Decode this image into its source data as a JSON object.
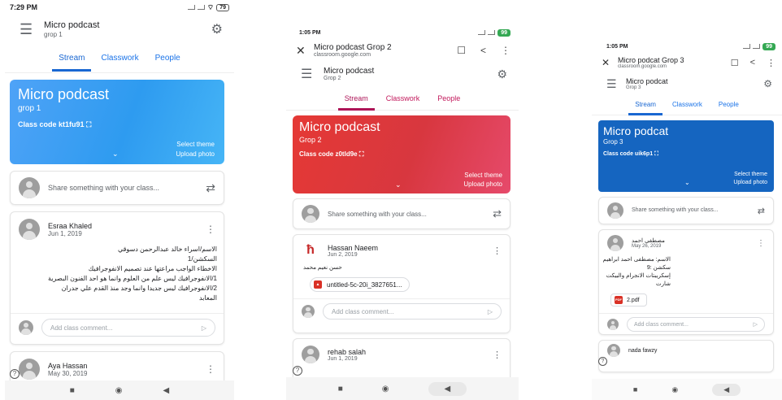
{
  "icons": {
    "menu": "☰",
    "gear": "⚙",
    "swap": "⇄",
    "kebab": "⋮",
    "send": "▷",
    "chevron": "⌄",
    "qr": "⛶",
    "close": "✕",
    "lock": "🔒",
    "bookmark": "☐",
    "share": "<",
    "nav_square": "■",
    "nav_circle": "◉",
    "nav_back": "◀",
    "help": "?"
  },
  "phones": [
    {
      "status_time": "7:29 PM",
      "battery": "79",
      "class_name": "Micro podcast",
      "section": "grop 1",
      "tabs": [
        "Stream",
        "Classwork",
        "People"
      ],
      "banner": {
        "title": "Micro podcast",
        "section": "grop 1",
        "class_code_label": "Class code",
        "class_code": "kt1fu91",
        "select_theme": "Select theme",
        "upload_photo": "Upload photo",
        "color": "#3ea3f5"
      },
      "share_placeholder": "Share something with your class...",
      "posts": [
        {
          "author": "Esraa Khaled",
          "date": "Jun 1, 2019",
          "lines": [
            "الاسم/اسراء خالد عبدالرحمن دسوقي",
            "السكشن/1",
            "الاخطاء الواجب مراعتها عند تصميم الانفوجرافيك",
            "1/الانفوجرافيك ليس علم من العلوم وانما هو احد الفنون البصرية",
            "2/الانفوجرافيك ليس جديدا وانما وجد منذ القدم علي جدران",
            "المعابد"
          ],
          "comment_placeholder": "Add class comment..."
        },
        {
          "author": "Aya Hassan",
          "date": "May 30, 2019"
        }
      ]
    },
    {
      "status_time": "1:05 PM",
      "battery": "99",
      "browser_title": "Micro podcast Grop 2",
      "browser_url": "classroom.google.com",
      "class_name": "Micro podcast",
      "section": "Grop 2",
      "tabs": [
        "Stream",
        "Classwork",
        "People"
      ],
      "banner": {
        "title": "Micro podcast",
        "section": "Grop 2",
        "class_code_label": "Class code",
        "class_code": "z0tld9e",
        "select_theme": "Select theme",
        "upload_photo": "Upload photo",
        "color": "#e0393e"
      },
      "share_placeholder": "Share something with your class...",
      "posts": [
        {
          "author": "Hassan Naeem",
          "date": "Jun 2, 2019",
          "lines": [
            "حسن نعيم محمد"
          ],
          "attachment": "untitled-5c-20i_3827651...",
          "comment_placeholder": "Add class comment..."
        },
        {
          "author": "rehab salah",
          "date": "Jun 1, 2019"
        }
      ]
    },
    {
      "status_time": "1:05 PM",
      "battery": "99",
      "browser_title": "Micro podcat Grop 3",
      "browser_url": "classroom.google.com",
      "class_name": "Micro podcat",
      "section": "Grop 3",
      "tabs": [
        "Stream",
        "Classwork",
        "People"
      ],
      "banner": {
        "title": "Micro podcat",
        "section": "Grop 3",
        "class_code_label": "Class code",
        "class_code": "uik6p1",
        "select_theme": "Select theme",
        "upload_photo": "Upload photo",
        "color": "#1565c0"
      },
      "share_placeholder": "Share something with your class...",
      "posts": [
        {
          "author": "مصطفى احمد",
          "date": "May 26, 2019",
          "lines": [
            "الاسم: مصطفى احمد ابراهيم",
            "سكشن :9",
            "إسكريبتات الانجرام والبيكت شارت"
          ],
          "attachment": "2.pdf",
          "comment_placeholder": "Add class comment..."
        },
        {
          "author": "nada fawzy"
        }
      ]
    }
  ]
}
